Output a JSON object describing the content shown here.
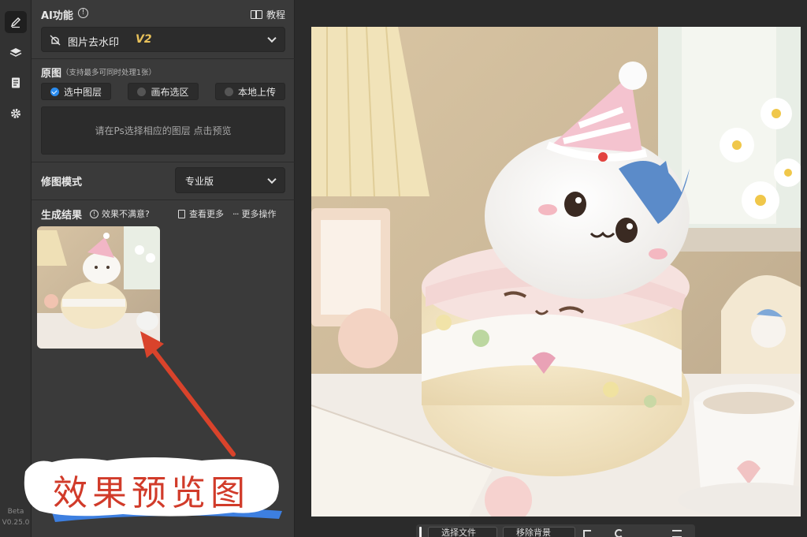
{
  "rail": {
    "icons": [
      "brush-icon",
      "layers-icon",
      "document-icon",
      "gear-icon"
    ],
    "version_label": "Beta",
    "version": "V0.25.0"
  },
  "ai": {
    "title": "AI功能",
    "tutorial": "教程",
    "feature": "图片去水印",
    "feature_version": "V2"
  },
  "source": {
    "title": "原图",
    "hint": "（支持最多可同时处理1张）",
    "options": [
      "选中图层",
      "画布选区",
      "本地上传"
    ],
    "selected_index": 0,
    "preview_hint": "请在Ps选择相应的图层 点击预览"
  },
  "mode": {
    "label": "修图模式",
    "value": "专业版"
  },
  "results": {
    "title": "生成结果",
    "unsatisfied": "效果不满意?",
    "view_more": "查看更多",
    "more_actions": "更多操作"
  },
  "annotation": {
    "text": "效果预览图"
  },
  "bottom_bar": {
    "select_file": "选择文件",
    "remove_bg": "移除背景"
  },
  "colors": {
    "accent": "#2a8cf0",
    "annotation_red": "#d13b2a",
    "version_gold": "#e8c15a"
  }
}
